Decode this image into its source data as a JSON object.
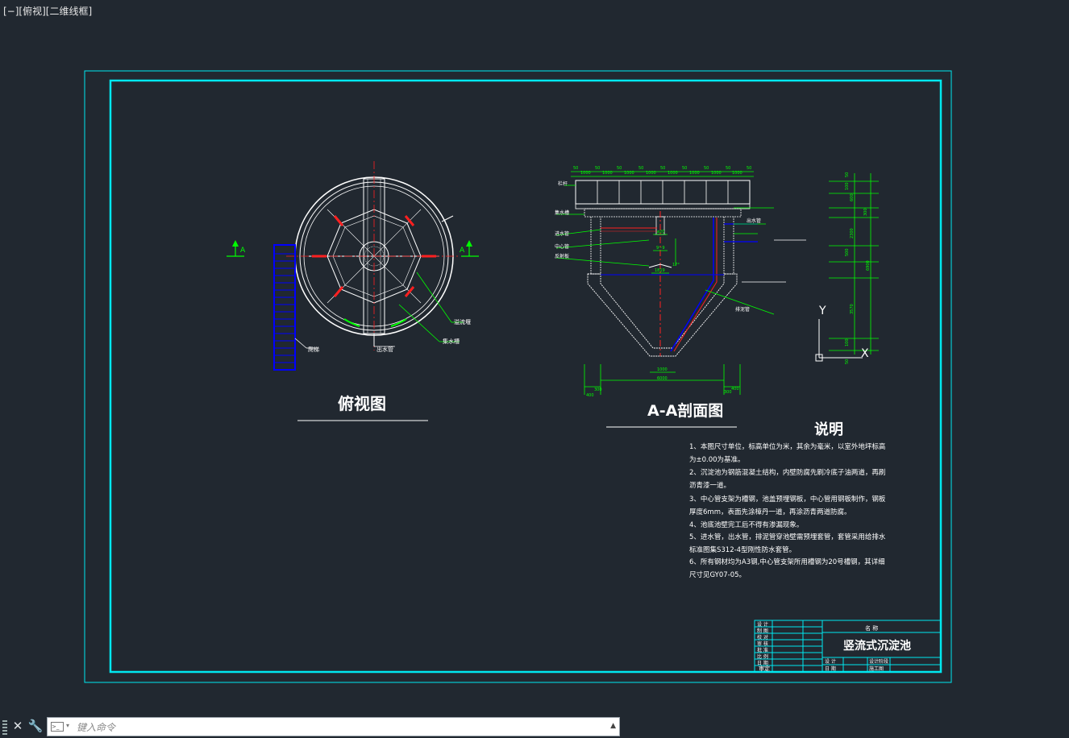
{
  "viewport": {
    "label": "[−][俯视][二维线框]"
  },
  "drawing": {
    "plan_view": {
      "title": "俯视图",
      "section_marker": "A",
      "label_ladder": "爬梯",
      "label_outlet": "出水管",
      "label_weir": "溢流堰",
      "label_trough": "集水槽"
    },
    "section_view": {
      "title": "A-A剖面图",
      "top_dims": [
        "50",
        "1000",
        "50",
        "1000",
        "50",
        "1000",
        "50",
        "1000",
        "50",
        "1000",
        "50",
        "1000",
        "50",
        "1000",
        "50",
        "1000",
        "50"
      ],
      "bottom_dims": [
        "400",
        "300",
        "1000",
        "6000",
        "300",
        "400"
      ],
      "mid_dims": [
        "ø20",
        "9~9",
        "1819",
        "17°"
      ],
      "labels": [
        "栏杆",
        "集水槽",
        "进水管",
        "中心管",
        "反射板",
        "排泥管",
        "出水管"
      ]
    },
    "elevation_dims": [
      "50",
      "100",
      "600",
      "300",
      "2300",
      "500",
      "6900",
      "3570",
      "100",
      "50"
    ],
    "notes": {
      "heading": "说明",
      "lines": [
        "1、本图尺寸单位，标高单位为米，其余为毫米，以室外地坪标高",
        "为±0.00为基准。",
        "2、沉淀池为钢筋混凝土结构，内壁防腐先刷冷底子油两道，再刷",
        "沥青漆一道。",
        "3、中心管支架为槽钢，池盖预埋钢板，中心管用钢板制作，钢板",
        "厚度6mm，表面先涂樟丹一道，再涂沥青两道防腐。",
        "4、池底池壁完工后不得有渗漏现象。",
        "5、进水管，出水管，排泥管穿池壁需预埋套管，套管采用给排水",
        "标准图集S312-4型刚性防水套管。",
        "6、所有钢材均为A3钢,中心管支架所用槽钢为20号槽钢，其详细",
        "尺寸见GY07-05。"
      ]
    },
    "title_block": {
      "name_header": "名 称",
      "drawing_name": "竖流式沉淀池",
      "left_rows": [
        "设 计",
        "制 图",
        "校 对",
        "审 核",
        "批 准",
        "比 例",
        "日 期"
      ],
      "bottom_left": "审定",
      "bottom_cells": [
        "设 计",
        "日 期",
        "设计阶段",
        "施工图"
      ]
    },
    "ucs": {
      "y_label": "Y",
      "x_label": "X"
    }
  },
  "command_line": {
    "placeholder": "键入命令"
  },
  "colors": {
    "background": "#212830",
    "border_cyan": "#00e8f0",
    "dim_green": "#00ff00",
    "ladder_blue": "#0000ff",
    "center_red": "#ff2020"
  }
}
